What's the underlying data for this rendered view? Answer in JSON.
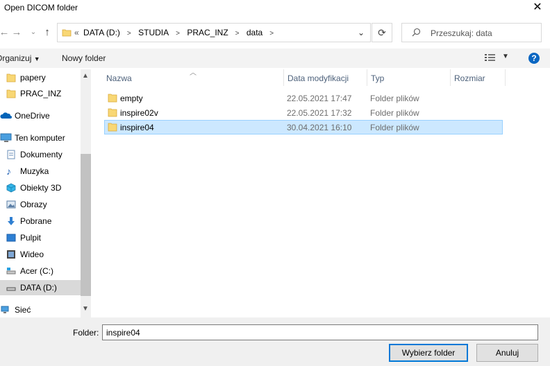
{
  "window": {
    "title": "Open DICOM folder"
  },
  "nav": {
    "breadcrumbs": [
      "DATA (D:)",
      "STUDIA",
      "PRAC_INZ",
      "data"
    ],
    "search_placeholder": "Przeszukaj: data"
  },
  "toolbar": {
    "organize": "Organizuj",
    "new_folder": "Nowy folder"
  },
  "sidebar": {
    "items": [
      {
        "label": "papery",
        "icon": "folder-icon"
      },
      {
        "label": "PRAC_INZ",
        "icon": "folder-icon"
      },
      {
        "label": "OneDrive",
        "icon": "cloud-icon"
      },
      {
        "label": "Ten komputer",
        "icon": "computer-icon"
      },
      {
        "label": "Dokumenty",
        "icon": "documents-icon"
      },
      {
        "label": "Muzyka",
        "icon": "music-icon"
      },
      {
        "label": "Obiekty 3D",
        "icon": "cube-icon"
      },
      {
        "label": "Obrazy",
        "icon": "pictures-icon"
      },
      {
        "label": "Pobrane",
        "icon": "download-icon"
      },
      {
        "label": "Pulpit",
        "icon": "desktop-icon"
      },
      {
        "label": "Wideo",
        "icon": "video-icon"
      },
      {
        "label": "Acer (C:)",
        "icon": "drive-icon"
      },
      {
        "label": "DATA (D:)",
        "icon": "drive-icon"
      },
      {
        "label": "Sieć",
        "icon": "network-icon"
      }
    ],
    "selected": "DATA (D:)"
  },
  "columns": {
    "name": "Nazwa",
    "date": "Data modyfikacji",
    "type": "Typ",
    "size": "Rozmiar"
  },
  "files": [
    {
      "name": "empty",
      "date": "22.05.2021 17:47",
      "type": "Folder plików"
    },
    {
      "name": "inspire02v",
      "date": "22.05.2021 17:32",
      "type": "Folder plików"
    },
    {
      "name": "inspire04",
      "date": "30.04.2021 16:10",
      "type": "Folder plików"
    }
  ],
  "selected_file": "inspire04",
  "footer": {
    "folder_label": "Folder:",
    "folder_value": "inspire04",
    "select_button": "Wybierz folder",
    "cancel_button": "Anuluj"
  },
  "colors": {
    "selection": "#cce8ff",
    "selection_border": "#99d1ff",
    "folder": "#f8d775",
    "accent": "#0078d7"
  }
}
